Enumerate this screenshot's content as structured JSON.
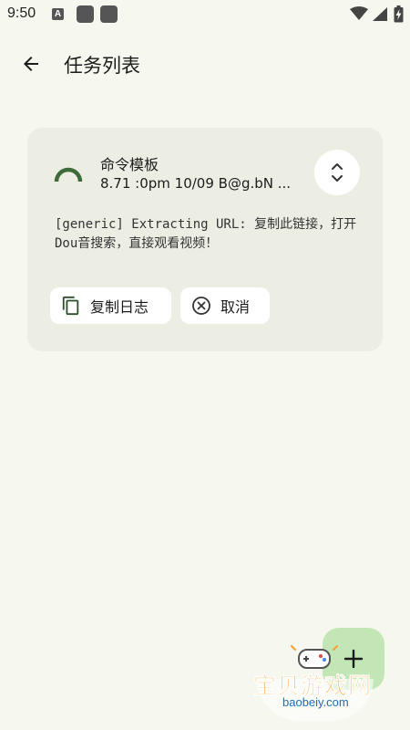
{
  "status_bar": {
    "time": "9:50",
    "notification_icon_letter": "A",
    "icons": [
      "notification-a-icon",
      "app-square-icon",
      "app-square-icon",
      "wifi-icon",
      "signal-icon",
      "battery-charging-icon"
    ]
  },
  "app_bar": {
    "back_icon": "arrow-back-icon",
    "title": "任务列表"
  },
  "task": {
    "title": "命令模板",
    "subtitle": "8.71 :0pm 10/09 B@g.bN ...",
    "log": "[generic] Extracting URL: 复制此链接，打开Dou音搜索，直接观看视频！",
    "expand_icon": "expand-collapse-icon",
    "actions": {
      "copy_log_label": "复制日志",
      "copy_icon": "copy-icon",
      "cancel_label": "取消",
      "cancel_icon": "cancel-circle-icon"
    }
  },
  "fab": {
    "icon": "plus-icon"
  },
  "watermark": {
    "text": "宝贝游戏网",
    "url": "baobeiy.com"
  },
  "colors": {
    "background": "#f6f7ee",
    "card": "#eceee4",
    "progress": "#3f6b3a",
    "fab": "#c3e6b6",
    "watermark_text": "#f2a230",
    "watermark_url": "#1d6fb8"
  }
}
